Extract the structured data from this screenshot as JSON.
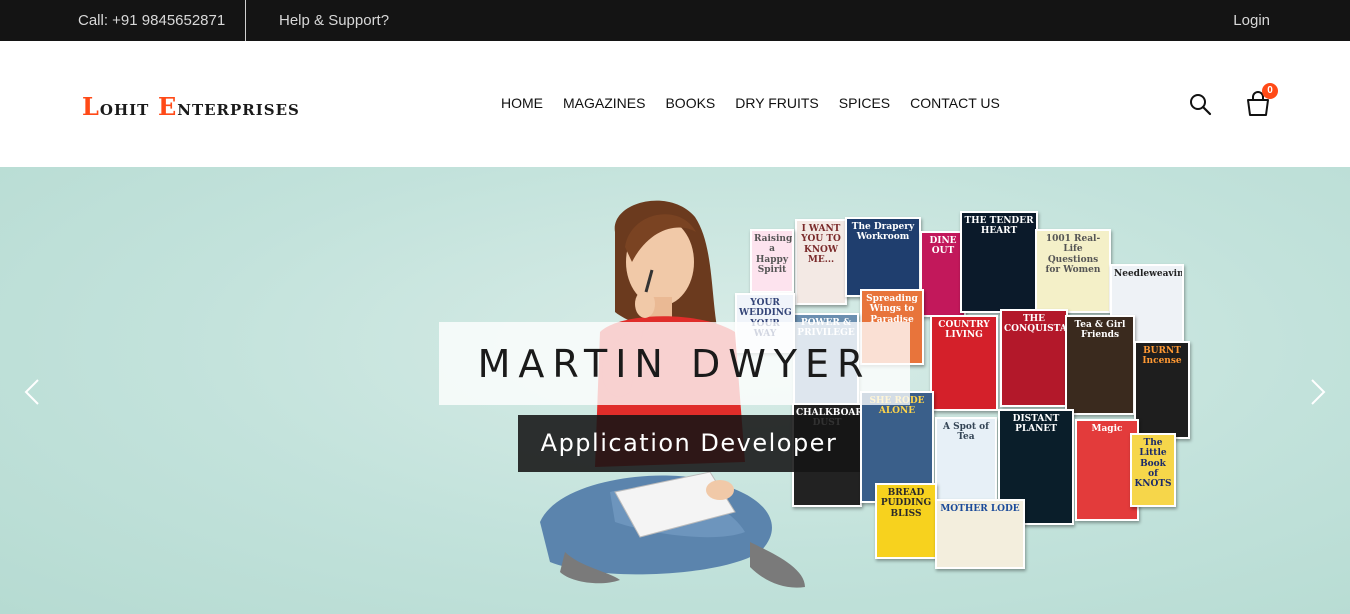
{
  "topbar": {
    "call": "Call: +91 9845652871",
    "help": "Help & Support?",
    "login": "Login"
  },
  "header": {
    "logo": {
      "l_initial": "L",
      "l_rest": "ohit ",
      "e_initial": "E",
      "e_rest": "nterprises"
    },
    "nav": [
      "HOME",
      "MAGAZINES",
      "BOOKS",
      "DRY FRUITS",
      "SPICES",
      "CONTACT US"
    ],
    "cart_count": "0"
  },
  "hero": {
    "title": "MARTIN DWYER",
    "subtitle": "Application Developer",
    "books": [
      {
        "title": "I WANT YOU TO KNOW ME...",
        "color": "#f3e9e4",
        "text_color": "#7a2a2a"
      },
      {
        "title": "The Drapery Workroom",
        "color": "#1f3e6e",
        "text_color": "#ffffff"
      },
      {
        "title": "DINE OUT",
        "color": "#c2185b",
        "text_color": "#ffffff"
      },
      {
        "title": "THE TENDER HEART",
        "color": "#0b1a2a",
        "text_color": "#ffffff"
      },
      {
        "title": "1001 Real-Life Questions for Women",
        "color": "#f4f0c8",
        "text_color": "#555555"
      },
      {
        "title": "Needleweaving",
        "color": "#eef2f6",
        "text_color": "#222222"
      },
      {
        "title": "Spreading Wings to Paradise",
        "color": "#e8743b",
        "text_color": "#ffffff"
      },
      {
        "title": "POWER & PRIVILEGE",
        "color": "#6b8fb0",
        "text_color": "#ffffff"
      },
      {
        "title": "COUNTRY LIVING",
        "color": "#d4202a",
        "text_color": "#ffffff"
      },
      {
        "title": "THE CONQUISTADORS",
        "color": "#b3182a",
        "text_color": "#ffffff"
      },
      {
        "title": "Tea & Girl Friends",
        "color": "#3a2a1e",
        "text_color": "#ffffff"
      },
      {
        "title": "BURNT Incense",
        "color": "#1e1e1e",
        "text_color": "#ff9933"
      },
      {
        "title": "CHALKBOARD DUST",
        "color": "#222222",
        "text_color": "#ffffff"
      },
      {
        "title": "SHE RODE ALONE",
        "color": "#3a5f8a",
        "text_color": "#ffd54a"
      },
      {
        "title": "A Spot of Tea",
        "color": "#e7f0f7",
        "text_color": "#334455"
      },
      {
        "title": "DISTANT PLANET",
        "color": "#0a1e2a",
        "text_color": "#ffffff"
      },
      {
        "title": "Magic",
        "color": "#e33b3b",
        "text_color": "#ffffff"
      },
      {
        "title": "The Little Book of KNOTS",
        "color": "#f6d64a",
        "text_color": "#1a2a6a"
      },
      {
        "title": "BREAD PUDDING BLISS",
        "color": "#f7d21e",
        "text_color": "#2a2a2a"
      },
      {
        "title": "MOTHER LODE",
        "color": "#f3eedd",
        "text_color": "#1a4a9a"
      },
      {
        "title": "Raising a Happy Spirit",
        "color": "#fde3ee",
        "text_color": "#555555"
      },
      {
        "title": "YOUR WEDDING YOUR WAY",
        "color": "#f0f4fa",
        "text_color": "#334477"
      }
    ]
  }
}
